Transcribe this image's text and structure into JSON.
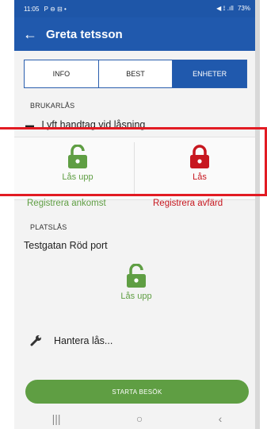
{
  "status_bar": {
    "time": "11:05",
    "left_icons": "P ⊖ ⊟ •",
    "battery": "73%",
    "right_icons": "◀ ⟟ .ıll"
  },
  "app_bar": {
    "back_icon": "arrow-left-icon",
    "title": "Greta tetsson"
  },
  "tabs": [
    {
      "label": "INFO",
      "active": false
    },
    {
      "label": "BEST",
      "active": false
    },
    {
      "label": "ENHETER",
      "active": true
    }
  ],
  "brukarlas": {
    "label": "BRUKARLÅS",
    "handle_text": "Lyft handtag vid låsning",
    "unlock_label": "Lås upp",
    "lock_label": "Lås",
    "register_arrival": "Registrera ankomst",
    "register_departure": "Registrera avfärd"
  },
  "platslas": {
    "label": "PLATSLÅS",
    "location": "Testgatan Röd port",
    "unlock_label": "Lås upp"
  },
  "manage": {
    "label": "Hantera lås..."
  },
  "start_button": {
    "label": "STARTA BESÖK"
  },
  "colors": {
    "primary": "#2059ad",
    "green": "#5f9e43",
    "red": "#c7171f",
    "highlight": "#e21b23"
  }
}
